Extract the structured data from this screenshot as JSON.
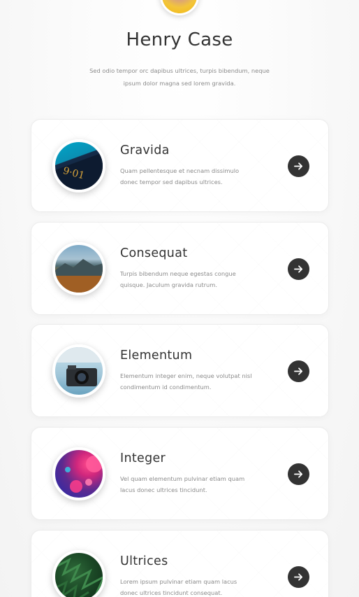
{
  "profile": {
    "name": "Henry Case",
    "bio": "Sed odio tempor orc dapibus ultrices, turpis bibendum, neque ipsum dolor magna sed lorem gravida."
  },
  "cards": [
    {
      "title": "Gravida",
      "text": "Quam pellentesque et necnam dissimulo donec tempor sed dapibus ultrices.",
      "image": "notebook-image"
    },
    {
      "title": "Consequat",
      "text": "Turpis bibendum neque egestas congue quisque. Jaculum gravida rutrum.",
      "image": "landscape-image"
    },
    {
      "title": "Elementum",
      "text": "Elementum integer enim, neque volutpat nisl condimentum id condimentum.",
      "image": "camera-image"
    },
    {
      "title": "Integer",
      "text": "Vel quam elementum pulvinar etiam quam lacus donec ultrices tincidunt.",
      "image": "abstract-bubbles-image"
    },
    {
      "title": "Ultrices",
      "text": "Lorem ipsum pulvinar etiam quam lacus donec ultrices tincidunt consequat.",
      "image": "pine-tree-image"
    }
  ],
  "icons": {
    "arrow": "arrow-right-icon"
  },
  "colors": {
    "button_bg": "#333333",
    "text_muted": "#8a8a8a",
    "heading": "#333333"
  }
}
